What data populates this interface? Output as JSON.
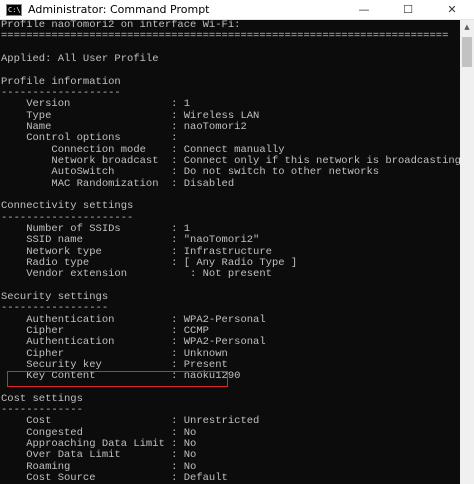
{
  "window": {
    "title": "Administrator: Command Prompt",
    "icon_label": "C:\\",
    "minimize_glyph": "—",
    "maximize_glyph": "☐",
    "close_glyph": "✕",
    "scroll_up_glyph": "▲"
  },
  "terminal": {
    "lines": [
      "Profile naoTomori2 on interface Wi-Fi:",
      "=======================================================================",
      "",
      "Applied: All User Profile",
      "",
      "Profile information",
      "-------------------",
      "    Version                : 1",
      "    Type                   : Wireless LAN",
      "    Name                   : naoTomori2",
      "    Control options        :",
      "        Connection mode    : Connect manually",
      "        Network broadcast  : Connect only if this network is broadcasting",
      "        AutoSwitch         : Do not switch to other networks",
      "        MAC Randomization  : Disabled",
      "",
      "Connectivity settings",
      "---------------------",
      "    Number of SSIDs        : 1",
      "    SSID name              : \"naoTomori2\"",
      "    Network type           : Infrastructure",
      "    Radio type             : [ Any Radio Type ]",
      "    Vendor extension          : Not present",
      "",
      "Security settings",
      "-----------------",
      "    Authentication         : WPA2-Personal",
      "    Cipher                 : CCMP",
      "    Authentication         : WPA2-Personal",
      "    Cipher                 : Unknown",
      "    Security key           : Present",
      "    Key Content            : naoku1290",
      "",
      "Cost settings",
      "-------------",
      "    Cost                   : Unrestricted",
      "    Congested              : No",
      "    Approaching Data Limit : No",
      "    Over Data Limit        : No",
      "    Roaming                : No",
      "    Cost Source            : Default"
    ]
  },
  "colors": {
    "terminal_bg": "#0c0c0c",
    "terminal_text": "#c0c0c0",
    "highlight_border": "#e0242a"
  }
}
